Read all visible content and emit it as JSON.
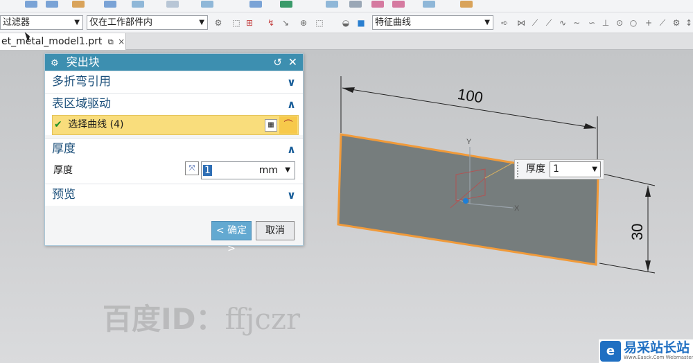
{
  "toolbar": {
    "filter_combo": "过滤器",
    "scope_combo": "仅在工作部件内",
    "curve_rule_combo": "特征曲线"
  },
  "tab": {
    "file_name": "et_metal_model1.prt",
    "pin_icon": "pin-icon",
    "close_icon": "close-icon"
  },
  "dialog": {
    "title": "突出块",
    "reset_icon": "reset-icon",
    "close_icon": "close-icon",
    "sections": {
      "bend_ref": "多折弯引用",
      "face_drive": "表区域驱动",
      "thickness": "厚度",
      "preview": "预览"
    },
    "select_curve": "选择曲线 (4)",
    "thickness_label": "厚度",
    "thickness_value": "1",
    "thickness_unit": "mm",
    "ok_label": "< 确定 >",
    "cancel_label": "取消"
  },
  "viewport": {
    "dim_width": "100",
    "dim_height": "30",
    "axis_y": "Y",
    "axis_x": "X",
    "handle_label": "厚度",
    "handle_value": "1",
    "sheet_fill": "#767d7d",
    "sheet_edge": "#f09a3a",
    "watermark_bold": "百度ID：",
    "watermark_light": "ffjczr"
  },
  "badge": {
    "title": "易采站长站",
    "sub": "Www.Easck.Com Webmaster"
  },
  "colors": {
    "dialog_title": "#3d8fb0",
    "selection_highlight": "#f9dd7c",
    "ok_button": "#63a9d1"
  }
}
